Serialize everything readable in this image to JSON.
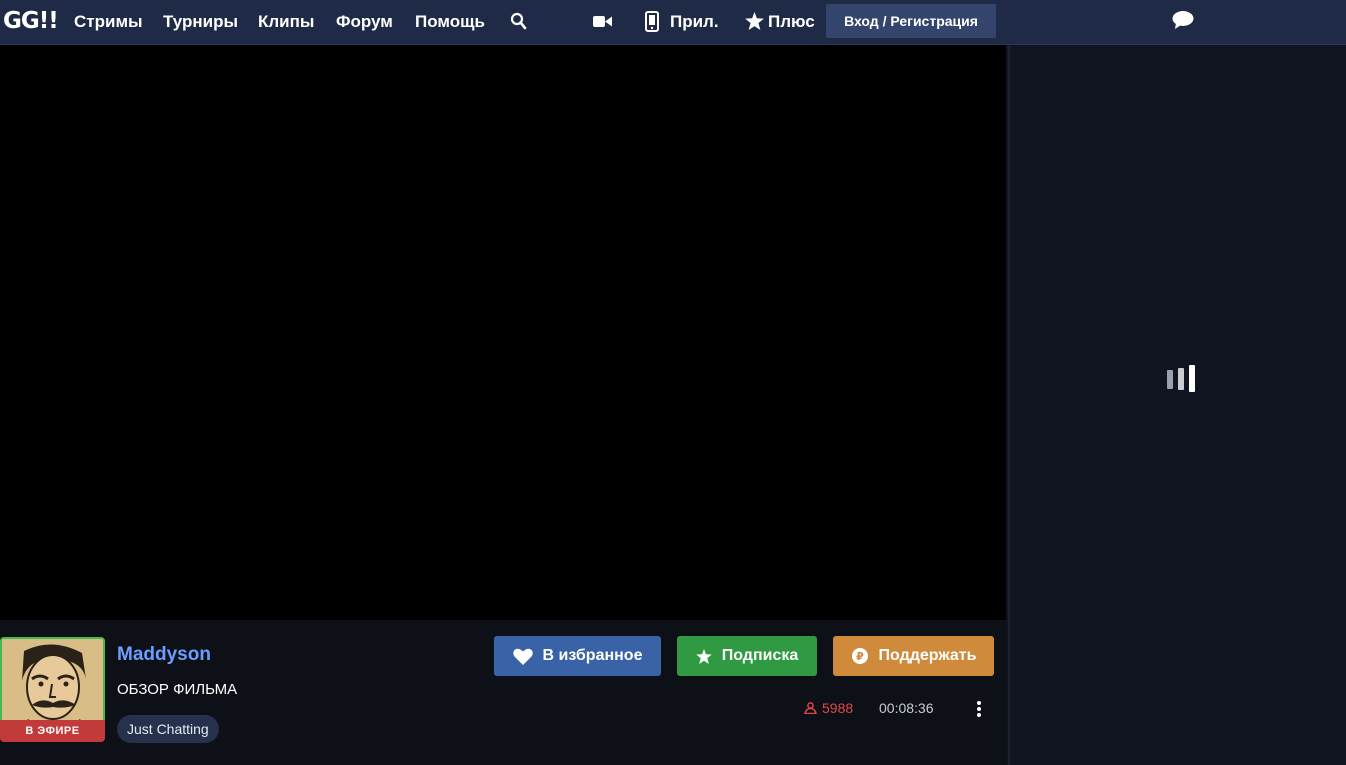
{
  "header": {
    "logo": "GG!!",
    "nav": [
      "Стримы",
      "Турниры",
      "Клипы",
      "Форум",
      "Помощь"
    ],
    "app_label": "Прил.",
    "plus_label": "Плюс",
    "login_label": "Вход / Регистрация",
    "icons": [
      "search-icon",
      "video-camera-icon",
      "phone-icon",
      "star-icon",
      "chat-bubble-icon"
    ]
  },
  "stream": {
    "live_badge": "В ЭФИРЕ",
    "streamer": "Maddyson",
    "title": "ОБЗОР ФИЛЬМА",
    "category": "Just Chatting",
    "viewers": "5988",
    "uptime": "00:08:36"
  },
  "actions": {
    "favorite": "В избранное",
    "subscribe": "Подписка",
    "donate": "Поддержать"
  },
  "colors": {
    "header_bg": "#1f2a47",
    "streamer_link": "#6b9eff",
    "favorite_btn": "#3a62a6",
    "subscribe_btn": "#2f9a42",
    "donate_btn": "#d08a3c",
    "live_badge": "#c23a3a",
    "viewers": "#e04646"
  }
}
